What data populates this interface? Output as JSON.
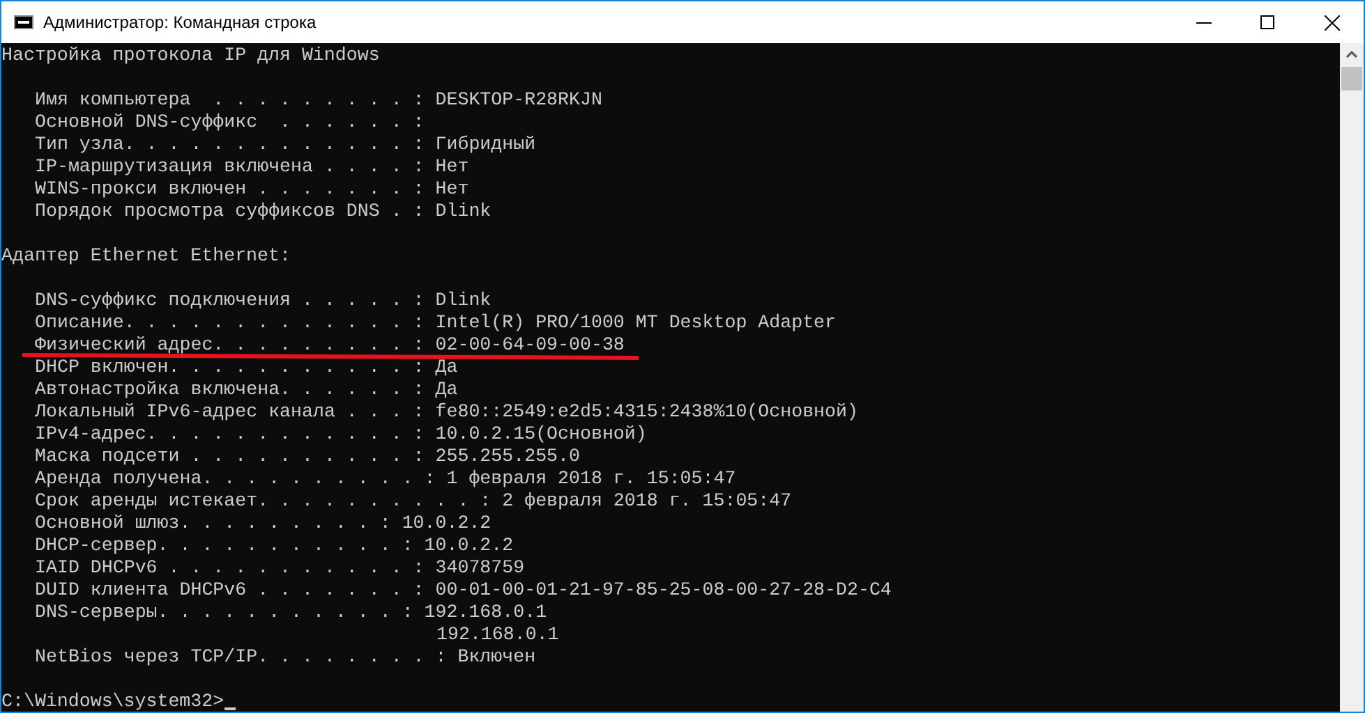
{
  "window": {
    "title": "Администратор: Командная строка"
  },
  "sections": [
    {
      "heading": "Настройка протокола IP для Windows",
      "lines": [
        {
          "kind": "entry",
          "text": "Имя компьютера  . . . . . . . . . : DESKTOP-R28RKJN",
          "underlined": false
        },
        {
          "kind": "entry",
          "text": "Основной DNS-суффикс  . . . . . . :",
          "underlined": false
        },
        {
          "kind": "entry",
          "text": "Тип узла. . . . . . . . . . . . . : Гибридный",
          "underlined": false
        },
        {
          "kind": "entry",
          "text": "IP-маршрутизация включена . . . . : Нет",
          "underlined": false
        },
        {
          "kind": "entry",
          "text": "WINS-прокси включен . . . . . . . : Нет",
          "underlined": false
        },
        {
          "kind": "entry",
          "text": "Порядок просмотра суффиксов DNS . : Dlink",
          "underlined": false
        }
      ]
    },
    {
      "heading": "Адаптер Ethernet Ethernet:",
      "lines": [
        {
          "kind": "entry",
          "text": "DNS-суффикс подключения . . . . . : Dlink",
          "underlined": false
        },
        {
          "kind": "entry",
          "text": "Описание. . . . . . . . . . . . . : Intel(R) PRO/1000 MT Desktop Adapter",
          "underlined": false
        },
        {
          "kind": "entry",
          "text": "Физический адрес. . . . . . . . . : 02-00-64-09-00-38",
          "underlined": true
        },
        {
          "kind": "entry",
          "text": "DHCP включен. . . . . . . . . . . : Да",
          "underlined": false
        },
        {
          "kind": "entry",
          "text": "Автонастройка включена. . . . . . : Да",
          "underlined": false
        },
        {
          "kind": "entry",
          "text": "Локальный IPv6-адрес канала . . . : fe80::2549:e2d5:4315:2438%10(Основной)",
          "underlined": false
        },
        {
          "kind": "entry",
          "text": "IPv4-адрес. . . . . . . . . . . . : 10.0.2.15(Основной)",
          "underlined": false
        },
        {
          "kind": "entry",
          "text": "Маска подсети . . . . . . . . . . : 255.255.255.0",
          "underlined": false
        },
        {
          "kind": "entry",
          "text": "Аренда получена. . . . . . . . . . : 1 февраля 2018 г. 15:05:47",
          "underlined": false
        },
        {
          "kind": "entry",
          "text": "Срок аренды истекает. . . . . . . . . . : 2 февраля 2018 г. 15:05:47",
          "underlined": false
        },
        {
          "kind": "entry",
          "text": "Основной шлюз. . . . . . . . . : 10.0.2.2",
          "underlined": false
        },
        {
          "kind": "entry",
          "text": "DHCP-сервер. . . . . . . . . . . : 10.0.2.2",
          "underlined": false
        },
        {
          "kind": "entry",
          "text": "IAID DHCPv6 . . . . . . . . . . . : 34078759",
          "underlined": false
        },
        {
          "kind": "entry",
          "text": "DUID клиента DHCPv6 . . . . . . . : 00-01-00-01-21-97-85-25-08-00-27-28-D2-C4",
          "underlined": false
        },
        {
          "kind": "entry",
          "text": "DNS-серверы. . . . . . . . . . . : 192.168.0.1",
          "underlined": false
        },
        {
          "kind": "continuation",
          "text": "192.168.0.1",
          "underlined": false
        },
        {
          "kind": "entry",
          "text": "NetBios через TCP/IP. . . . . . . . : Включен",
          "underlined": false
        }
      ]
    }
  ],
  "prompt": "C:\\Windows\\system32>"
}
